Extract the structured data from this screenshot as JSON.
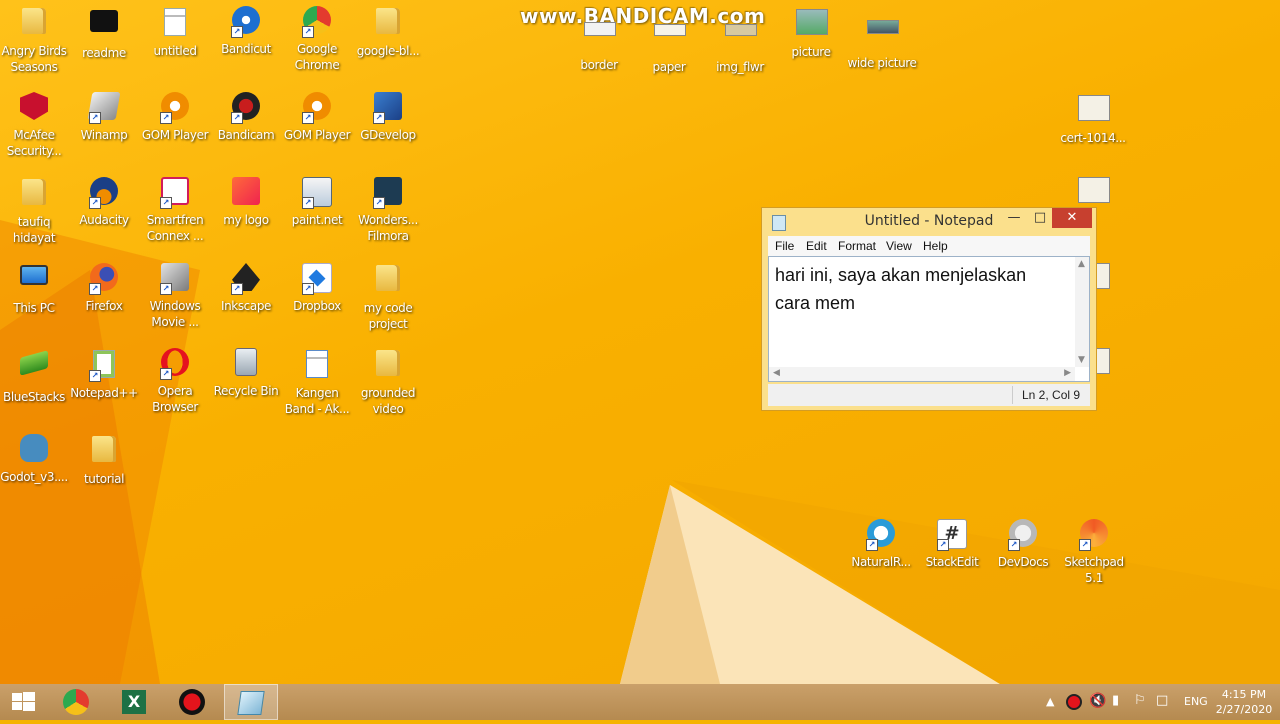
{
  "watermark": "www.BANDICAM.com",
  "desktop_icons": [
    {
      "label": "Angry Birds Seasons",
      "icon": "folder-icon"
    },
    {
      "label": "readme",
      "icon": "black-file-icon"
    },
    {
      "label": "untitled",
      "icon": "text-document-icon"
    },
    {
      "label": "Bandicut",
      "icon": "bandicut-icon"
    },
    {
      "label": "Google Chrome",
      "icon": "chrome-icon"
    },
    {
      "label": "google-bl...",
      "icon": "folder-icon"
    },
    {
      "label": "border",
      "icon": "image-file-icon"
    },
    {
      "label": "paper",
      "icon": "image-file-icon"
    },
    {
      "label": "img_flwr",
      "icon": "image-file-icon"
    },
    {
      "label": "picture",
      "icon": "image-file-icon"
    },
    {
      "label": "wide picture",
      "icon": "image-file-icon"
    },
    {
      "label": "McAfee Security...",
      "icon": "mcafee-icon"
    },
    {
      "label": "Winamp",
      "icon": "winamp-icon"
    },
    {
      "label": "GOM Player",
      "icon": "gom-player-icon"
    },
    {
      "label": "Bandicam",
      "icon": "bandicam-icon"
    },
    {
      "label": "GOM Player",
      "icon": "gom-player-icon"
    },
    {
      "label": "GDevelop",
      "icon": "gdevelop-icon"
    },
    {
      "label": "cert-1014...",
      "icon": "certificate-file-icon"
    },
    {
      "label": "taufiq hidayat",
      "icon": "user-folder-icon"
    },
    {
      "label": "Audacity",
      "icon": "audacity-icon"
    },
    {
      "label": "Smartfren Connex ...",
      "icon": "smartfren-icon"
    },
    {
      "label": "my logo",
      "icon": "image-file-icon"
    },
    {
      "label": "paint.net",
      "icon": "paintnet-icon"
    },
    {
      "label": "Wonders... Filmora",
      "icon": "filmora-icon"
    },
    {
      "label": "This PC",
      "icon": "computer-icon"
    },
    {
      "label": "Firefox",
      "icon": "firefox-icon"
    },
    {
      "label": "Windows Movie ...",
      "icon": "movie-maker-icon"
    },
    {
      "label": "Inkscape",
      "icon": "inkscape-icon"
    },
    {
      "label": "Dropbox",
      "icon": "dropbox-icon"
    },
    {
      "label": "my code project",
      "icon": "folder-icon"
    },
    {
      "label": "BlueStacks",
      "icon": "bluestacks-icon"
    },
    {
      "label": "Notepad++",
      "icon": "notepadpp-icon"
    },
    {
      "label": "Opera Browser",
      "icon": "opera-icon"
    },
    {
      "label": "Recycle Bin",
      "icon": "recycle-bin-icon"
    },
    {
      "label": "Kangen Band - Ak...",
      "icon": "mp3-file-icon"
    },
    {
      "label": "grounded video",
      "icon": "folder-icon"
    },
    {
      "label": "Godot_v3....",
      "icon": "godot-icon"
    },
    {
      "label": "tutorial",
      "icon": "folder-icon"
    },
    {
      "label": "NaturalR...",
      "icon": "naturalreader-icon"
    },
    {
      "label": "StackEdit",
      "icon": "stackedit-icon"
    },
    {
      "label": "DevDocs",
      "icon": "devdocs-icon"
    },
    {
      "label": "Sketchpad 5.1",
      "icon": "sketchpad-icon"
    }
  ],
  "notepad": {
    "title": "Untitled - Notepad",
    "menu": [
      "File",
      "Edit",
      "Format",
      "View",
      "Help"
    ],
    "content": "hari ini, saya akan menjelaskan\ncara mem",
    "status": "Ln 2, Col 9"
  },
  "taskbar": {
    "apps": [
      "start-icon",
      "chrome-icon",
      "excel-icon",
      "bandicam-record-icon",
      "notepad-icon"
    ],
    "language": "ENG",
    "time": "4:15 PM",
    "date": "2/27/2020"
  },
  "colors": {
    "desktop_accent": "#f9b000",
    "close_button": "#c7402f",
    "notepad_frame": "#fbe08c"
  }
}
